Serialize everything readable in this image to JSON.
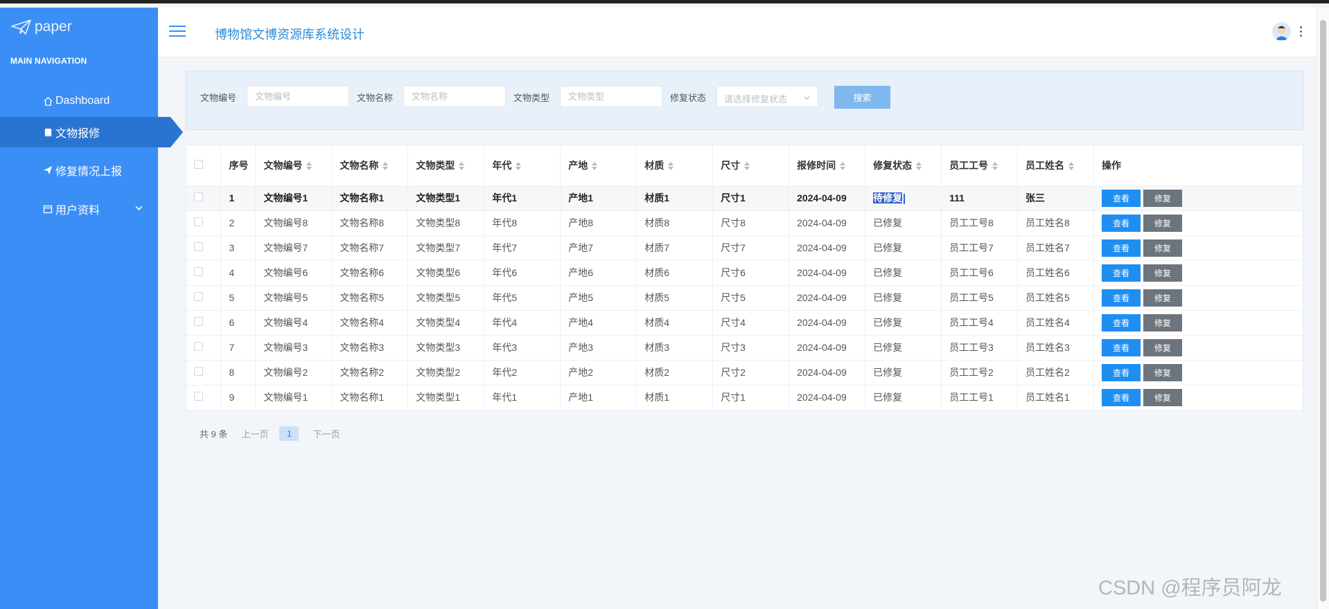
{
  "sidebar": {
    "logo_text": "paper",
    "nav_heading": "MAIN NAVIGATION",
    "items": [
      {
        "label": "Dashboard",
        "icon": "home-icon"
      },
      {
        "label": "文物报修",
        "icon": "book-icon"
      },
      {
        "label": "修复情况上报",
        "icon": "send-icon"
      },
      {
        "label": "用户资料",
        "icon": "calendar-icon"
      }
    ]
  },
  "header": {
    "title": "博物馆文博资源库系统设计"
  },
  "search": {
    "fields": [
      {
        "label": "文物编号",
        "placeholder": "文物编号"
      },
      {
        "label": "文物名称",
        "placeholder": "文物名称"
      },
      {
        "label": "文物类型",
        "placeholder": "文物类型"
      }
    ],
    "status_label": "修复状态",
    "status_placeholder": "请选择修复状态",
    "button": "搜索"
  },
  "table": {
    "columns": [
      "序号",
      "文物编号",
      "文物名称",
      "文物类型",
      "年代",
      "产地",
      "材质",
      "尺寸",
      "报修时间",
      "修复状态",
      "员工工号",
      "员工姓名",
      "操作"
    ],
    "view_label": "查看",
    "repair_label": "修复",
    "rows": [
      [
        "1",
        "文物编号1",
        "文物名称1",
        "文物类型1",
        "年代1",
        "产地1",
        "材质1",
        "尺寸1",
        "2024-04-09",
        "待修复",
        "111",
        "张三"
      ],
      [
        "2",
        "文物编号8",
        "文物名称8",
        "文物类型8",
        "年代8",
        "产地8",
        "材质8",
        "尺寸8",
        "2024-04-09",
        "已修复",
        "员工工号8",
        "员工姓名8"
      ],
      [
        "3",
        "文物编号7",
        "文物名称7",
        "文物类型7",
        "年代7",
        "产地7",
        "材质7",
        "尺寸7",
        "2024-04-09",
        "已修复",
        "员工工号7",
        "员工姓名7"
      ],
      [
        "4",
        "文物编号6",
        "文物名称6",
        "文物类型6",
        "年代6",
        "产地6",
        "材质6",
        "尺寸6",
        "2024-04-09",
        "已修复",
        "员工工号6",
        "员工姓名6"
      ],
      [
        "5",
        "文物编号5",
        "文物名称5",
        "文物类型5",
        "年代5",
        "产地5",
        "材质5",
        "尺寸5",
        "2024-04-09",
        "已修复",
        "员工工号5",
        "员工姓名5"
      ],
      [
        "6",
        "文物编号4",
        "文物名称4",
        "文物类型4",
        "年代4",
        "产地4",
        "材质4",
        "尺寸4",
        "2024-04-09",
        "已修复",
        "员工工号4",
        "员工姓名4"
      ],
      [
        "7",
        "文物编号3",
        "文物名称3",
        "文物类型3",
        "年代3",
        "产地3",
        "材质3",
        "尺寸3",
        "2024-04-09",
        "已修复",
        "员工工号3",
        "员工姓名3"
      ],
      [
        "8",
        "文物编号2",
        "文物名称2",
        "文物类型2",
        "年代2",
        "产地2",
        "材质2",
        "尺寸2",
        "2024-04-09",
        "已修复",
        "员工工号2",
        "员工姓名2"
      ],
      [
        "9",
        "文物编号1",
        "文物名称1",
        "文物类型1",
        "年代1",
        "产地1",
        "材质1",
        "尺寸1",
        "2024-04-09",
        "已修复",
        "员工工号1",
        "员工姓名1"
      ]
    ]
  },
  "pagination": {
    "total": "共 9 条",
    "prev": "上一页",
    "current": "1",
    "next": "下一页"
  },
  "watermark": "CSDN @程序员阿龙"
}
